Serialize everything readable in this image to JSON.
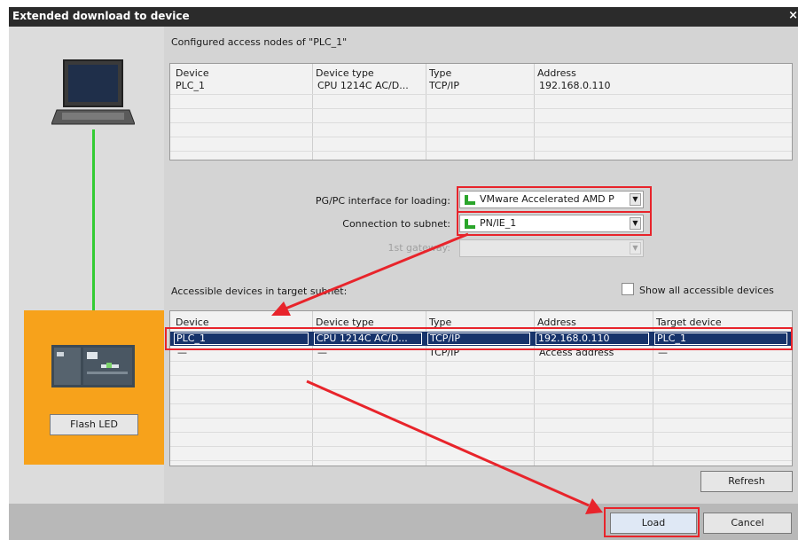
{
  "dialog": {
    "title": "Extended download to device",
    "close_glyph": "×"
  },
  "configured": {
    "label": "Configured access nodes of \"PLC_1\"",
    "columns": [
      "Device",
      "Device type",
      "Type",
      "Address"
    ],
    "rows": [
      [
        "PLC_1",
        "CPU 1214C AC/D...",
        "TCP/IP",
        "192.168.0.110"
      ]
    ]
  },
  "form": {
    "pgpc_label": "PG/PC interface for loading:",
    "pgpc_value": "VMware Accelerated AMD P",
    "subnet_label": "Connection to subnet:",
    "subnet_value": "PN/IE_1",
    "gateway_label": "1st gateway:",
    "gateway_value": ""
  },
  "accessible": {
    "label": "Accessible devices in target subnet:",
    "show_all_label": "Show all accessible devices",
    "show_all_checked": false,
    "columns": [
      "Device",
      "Device type",
      "Type",
      "Address",
      "Target device"
    ],
    "rows": [
      [
        "PLC_1",
        "CPU 1214C AC/D...",
        "TCP/IP",
        "192.168.0.110",
        "PLC_1"
      ],
      [
        "—",
        "—",
        "TCP/IP",
        "Access address",
        "—"
      ]
    ]
  },
  "buttons": {
    "flash_led": "Flash LED",
    "refresh": "Refresh",
    "load": "Load",
    "cancel": "Cancel"
  },
  "colors": {
    "titlebar": "#2b2b2b",
    "selection": "#17336b",
    "highlight_red": "#e8242b",
    "device_panel": "#f7a21b",
    "link_green": "#33cc33"
  },
  "icons": {
    "pc": "laptop-icon",
    "plc": "plc-icon",
    "network": "network-adapter-icon"
  }
}
